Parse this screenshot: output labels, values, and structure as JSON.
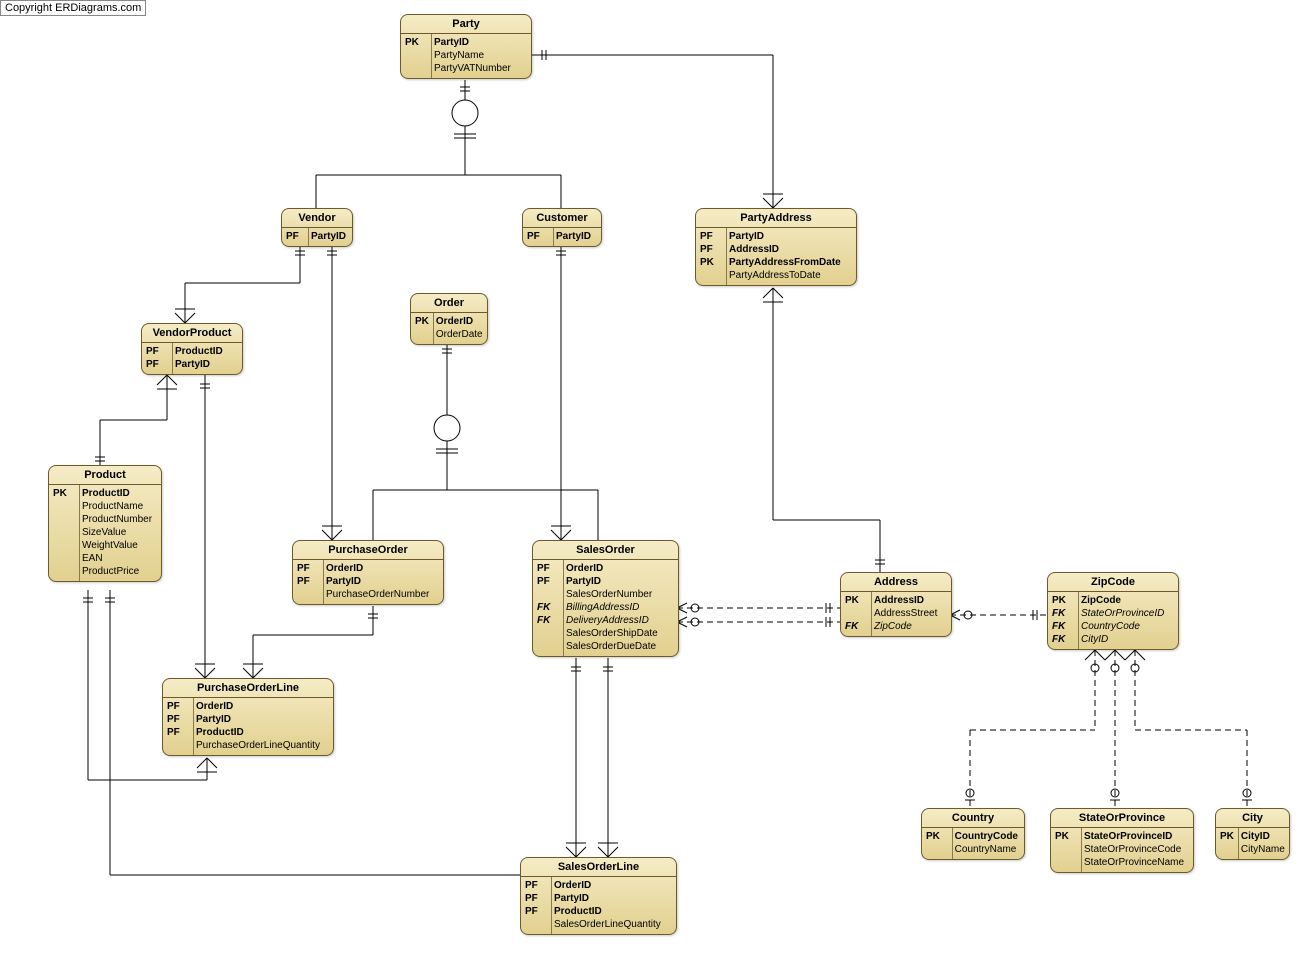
{
  "copyright": "Copyright ERDiagrams.com",
  "entities": {
    "party": {
      "title": "Party",
      "attrs": [
        {
          "key": "PK",
          "name": "PartyID",
          "bold": true
        },
        {
          "key": "",
          "name": "PartyName"
        },
        {
          "key": "",
          "name": "PartyVATNumber"
        }
      ]
    },
    "vendor": {
      "title": "Vendor",
      "attrs": [
        {
          "key": "PF",
          "name": "PartyID",
          "bold": true
        }
      ]
    },
    "customer": {
      "title": "Customer",
      "attrs": [
        {
          "key": "PF",
          "name": "PartyID",
          "bold": true
        }
      ]
    },
    "partyaddress": {
      "title": "PartyAddress",
      "attrs": [
        {
          "key": "PF",
          "name": "PartyID",
          "bold": true
        },
        {
          "key": "PF",
          "name": "AddressID",
          "bold": true
        },
        {
          "key": "PK",
          "name": "PartyAddressFromDate",
          "bold": true
        },
        {
          "key": "",
          "name": "PartyAddressToDate"
        }
      ]
    },
    "order": {
      "title": "Order",
      "attrs": [
        {
          "key": "PK",
          "name": "OrderID",
          "bold": true
        },
        {
          "key": "",
          "name": "OrderDate"
        }
      ]
    },
    "vendorproduct": {
      "title": "VendorProduct",
      "attrs": [
        {
          "key": "PF",
          "name": "ProductID",
          "bold": true
        },
        {
          "key": "PF",
          "name": "PartyID",
          "bold": true
        }
      ]
    },
    "product": {
      "title": "Product",
      "attrs": [
        {
          "key": "PK",
          "name": "ProductID",
          "bold": true
        },
        {
          "key": "",
          "name": "ProductName"
        },
        {
          "key": "",
          "name": "ProductNumber"
        },
        {
          "key": "",
          "name": "SizeValue"
        },
        {
          "key": "",
          "name": "WeightValue"
        },
        {
          "key": "",
          "name": "EAN"
        },
        {
          "key": "",
          "name": "ProductPrice"
        }
      ]
    },
    "purchaseorder": {
      "title": "PurchaseOrder",
      "attrs": [
        {
          "key": "PF",
          "name": "OrderID",
          "bold": true
        },
        {
          "key": "PF",
          "name": "PartyID",
          "bold": true
        },
        {
          "key": "",
          "name": "PurchaseOrderNumber"
        }
      ]
    },
    "salesorder": {
      "title": "SalesOrder",
      "attrs": [
        {
          "key": "PF",
          "name": "OrderID",
          "bold": true
        },
        {
          "key": "PF",
          "name": "PartyID",
          "bold": true
        },
        {
          "key": "",
          "name": "SalesOrderNumber"
        },
        {
          "key": "FK",
          "name": "BillingAddressID",
          "italic": true,
          "keyitalic": true
        },
        {
          "key": "FK",
          "name": "DeliveryAddressID",
          "italic": true,
          "keyitalic": true
        },
        {
          "key": "",
          "name": "SalesOrderShipDate"
        },
        {
          "key": "",
          "name": "SalesOrderDueDate"
        }
      ]
    },
    "address": {
      "title": "Address",
      "attrs": [
        {
          "key": "PK",
          "name": "AddressID",
          "bold": true
        },
        {
          "key": "",
          "name": "AddressStreet"
        },
        {
          "key": "FK",
          "name": "ZipCode",
          "italic": true,
          "keyitalic": true
        }
      ]
    },
    "zipcode": {
      "title": "ZipCode",
      "attrs": [
        {
          "key": "PK",
          "name": "ZipCode",
          "bold": true
        },
        {
          "key": "FK",
          "name": "StateOrProvinceID",
          "italic": true,
          "keyitalic": true
        },
        {
          "key": "FK",
          "name": "CountryCode",
          "italic": true,
          "keyitalic": true
        },
        {
          "key": "FK",
          "name": "CityID",
          "italic": true,
          "keyitalic": true
        }
      ]
    },
    "purchaseorderline": {
      "title": "PurchaseOrderLine",
      "attrs": [
        {
          "key": "PF",
          "name": "OrderID",
          "bold": true
        },
        {
          "key": "PF",
          "name": "PartyID",
          "bold": true
        },
        {
          "key": "PF",
          "name": "ProductID",
          "bold": true
        },
        {
          "key": "",
          "name": "PurchaseOrderLineQuantity"
        }
      ]
    },
    "salesorderline": {
      "title": "SalesOrderLine",
      "attrs": [
        {
          "key": "PF",
          "name": "OrderID",
          "bold": true
        },
        {
          "key": "PF",
          "name": "PartyID",
          "bold": true
        },
        {
          "key": "PF",
          "name": "ProductID",
          "bold": true
        },
        {
          "key": "",
          "name": "SalesOrderLineQuantity"
        }
      ]
    },
    "country": {
      "title": "Country",
      "attrs": [
        {
          "key": "PK",
          "name": "CountryCode",
          "bold": true
        },
        {
          "key": "",
          "name": "CountryName"
        }
      ]
    },
    "stateorprovince": {
      "title": "StateOrProvince",
      "attrs": [
        {
          "key": "PK",
          "name": "StateOrProvinceID",
          "bold": true
        },
        {
          "key": "",
          "name": "StateOrProvinceCode"
        },
        {
          "key": "",
          "name": "StateOrProvinceName"
        }
      ]
    },
    "city": {
      "title": "City",
      "attrs": [
        {
          "key": "PK",
          "name": "CityID",
          "bold": true
        },
        {
          "key": "",
          "name": "CityName"
        }
      ]
    }
  }
}
